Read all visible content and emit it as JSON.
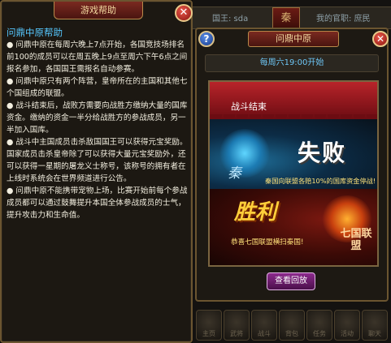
{
  "help_panel": {
    "tab_label": "游戏帮助",
    "close_symbol": "✕",
    "title": "问鼎中原帮助",
    "paragraphs": [
      "● 问鼎中原在每周六晚上7点开始，各国竞技场排名前100的成员可以在周五晚上9点至周六下午6点之间报名参加，各国国王需报名自动参赛。",
      "● 问鼎中原只有两个阵营，皇帝所在的主国和其他七个国组成的联盟。",
      "● 战斗结束后，战败方需要向战胜方缴纳大量的国库资金。缴纳的资金一半分给战胜方的参战成员，另一半加入国库。",
      "● 战斗中主国成员击杀敌国国王可以获得元宝奖励。国家成员击杀皇帝除了可以获得大量元宝奖励外，还可以获得一星期的屠龙义士称号，该称号的拥有者在上线时系统会在世界频道进行公告。",
      "● 问鼎中原不能携带宠物上场，比赛开始前每个参战成员都可以通过鼓舞提升本国全体参战成员的士气，提升攻击力和生命值。"
    ]
  },
  "top_bar": {
    "king_text": "国王: sda",
    "seal_char": "秦",
    "rank_text": "我的官职: 庶民"
  },
  "event_dialog": {
    "help_symbol": "?",
    "title": "问鼎中原",
    "close_symbol": "✕",
    "schedule": "每周六19:00开始",
    "result": {
      "banner_text": "战斗结束",
      "loser_char": "秦",
      "lose_text": "失败",
      "lose_desc": "秦国向联盟各赔10%的国库资金停战!",
      "win_text": "胜利",
      "alliance_name": "七国联盟",
      "win_desc": "恭喜七国联盟横扫秦国!"
    },
    "replay_label": "查看回放"
  },
  "bottom_bar": {
    "icons": [
      {
        "name": "home-icon",
        "label": "主页"
      },
      {
        "name": "general-icon",
        "label": "武将"
      },
      {
        "name": "fight-icon",
        "label": "战斗"
      },
      {
        "name": "bag-icon",
        "label": "背包"
      },
      {
        "name": "task-icon",
        "label": "任务"
      },
      {
        "name": "activity-icon",
        "label": "活动"
      },
      {
        "name": "chat-icon",
        "label": "聊天"
      }
    ]
  },
  "colors": {
    "title_blue": "#56c8ff",
    "gold_frame": "#6b5530",
    "banner_red": "#b8242a",
    "win_gold": "#ffcf3a",
    "desc_yellow": "#ffe27a",
    "replay_purple": "#8c2a8c"
  }
}
